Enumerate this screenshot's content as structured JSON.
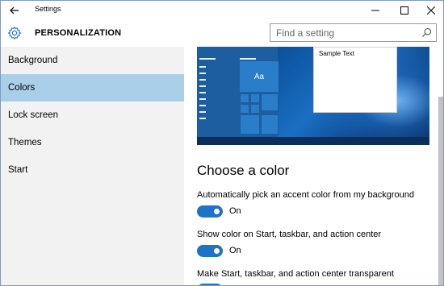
{
  "window": {
    "title": "Settings",
    "back_icon": "back-arrow-icon",
    "minimize_icon": "minimize-icon",
    "maximize_icon": "maximize-icon",
    "close_icon": "close-icon"
  },
  "header": {
    "icon": "gear-icon",
    "title": "PERSONALIZATION",
    "search": {
      "placeholder": "Find a setting",
      "value": "",
      "icon": "search-icon"
    }
  },
  "sidebar": {
    "items": [
      {
        "label": "Background",
        "selected": false
      },
      {
        "label": "Colors",
        "selected": true
      },
      {
        "label": "Lock screen",
        "selected": false
      },
      {
        "label": "Themes",
        "selected": false
      },
      {
        "label": "Start",
        "selected": false
      }
    ],
    "selected_color": "#a9cfe9"
  },
  "preview": {
    "tile_label": "Aa",
    "sample_text": "Sample Text",
    "accent_color": "#2a7dc8"
  },
  "main": {
    "section_title": "Choose a color",
    "settings": [
      {
        "label": "Automatically pick an accent color from my background",
        "state": "On"
      },
      {
        "label": "Show color on Start, taskbar, and action center",
        "state": "On"
      },
      {
        "label": "Make Start, taskbar, and action center transparent"
      }
    ],
    "toggle_color": "#1e73c7"
  }
}
